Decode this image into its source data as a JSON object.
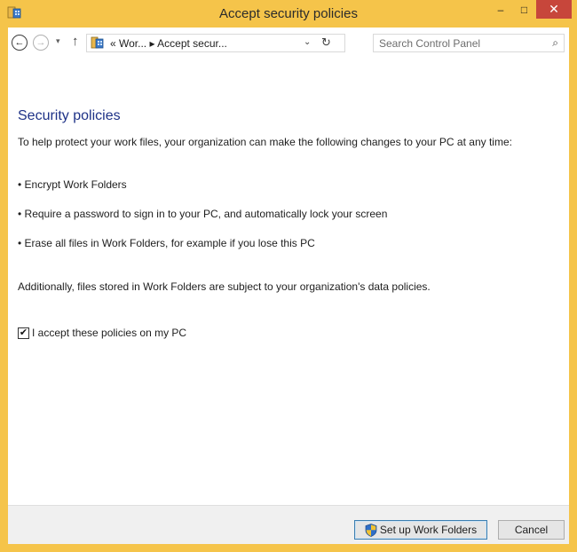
{
  "window": {
    "title": "Accept security policies",
    "controls": {
      "minimize": "–",
      "maximize": "□",
      "close": "✕"
    }
  },
  "addressbar": {
    "back_glyph": "←",
    "forward_glyph": "→",
    "recent_glyph": "▾",
    "up_glyph": "↑",
    "breadcrumb": "«  Wor...  ▸  Accept secur...",
    "dropdown_glyph": "⌄",
    "refresh_glyph": "↻",
    "search_placeholder": "Search Control Panel",
    "search_glyph": "⌕"
  },
  "content": {
    "heading": "Security policies",
    "intro": "To help protect your work files, your organization can make the following changes to your PC at any time:",
    "bullets": [
      "•  Encrypt Work Folders",
      "•  Require a password to sign in to your PC, and automatically lock your screen",
      "•  Erase all files in Work Folders, for example if you lose this PC"
    ],
    "additional": "Additionally, files stored in Work Folders are subject to your organization's data policies.",
    "accept_checkbox": {
      "checked_glyph": "✔",
      "label": "I accept these policies on my PC"
    }
  },
  "footer": {
    "setup_label": "Set up Work Folders",
    "cancel_label": "Cancel"
  },
  "colors": {
    "frame": "#f5c44a",
    "close": "#c7463b",
    "heading": "#1e3287",
    "footer": "#f0f0f0"
  },
  "icons": [
    "work-folders-icon",
    "back-icon",
    "forward-icon",
    "up-arrow-icon",
    "refresh-icon",
    "search-icon",
    "uac-shield-icon",
    "checkmark-icon"
  ]
}
